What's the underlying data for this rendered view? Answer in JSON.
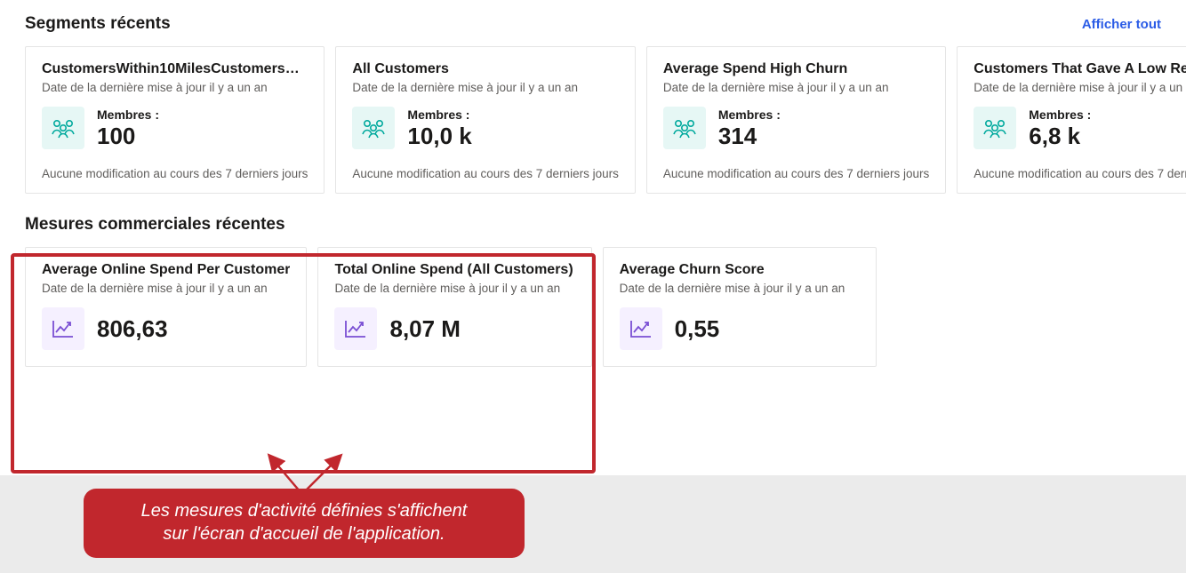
{
  "segments": {
    "title": "Segments récents",
    "view_all": "Afficher tout",
    "members_label": "Membres :",
    "change_text": "Aucune modification au cours des 7 derniers jours",
    "date_text": "Date de la dernière mise à jour il y a un an",
    "cards": [
      {
        "title": "CustomersWithin10MilesCustomers…",
        "value": "100"
      },
      {
        "title": "All Customers",
        "value": "10,0 k"
      },
      {
        "title": "Average Spend High Churn",
        "value": "314"
      },
      {
        "title": "Customers That Gave A Low Review …",
        "value": "6,8 k"
      }
    ]
  },
  "measures": {
    "title": "Mesures commerciales récentes",
    "date_text": "Date de la dernière mise à jour il y a un an",
    "cards": [
      {
        "title": "Average Online Spend Per Customer",
        "value": "806,63"
      },
      {
        "title": "Total Online Spend (All Customers)",
        "value": "8,07 M"
      },
      {
        "title": "Average Churn Score",
        "value": "0,55"
      }
    ]
  },
  "callout": {
    "line1": "Les mesures d'activité définies s'affichent",
    "line2": "sur l'écran d'accueil de l'application."
  }
}
